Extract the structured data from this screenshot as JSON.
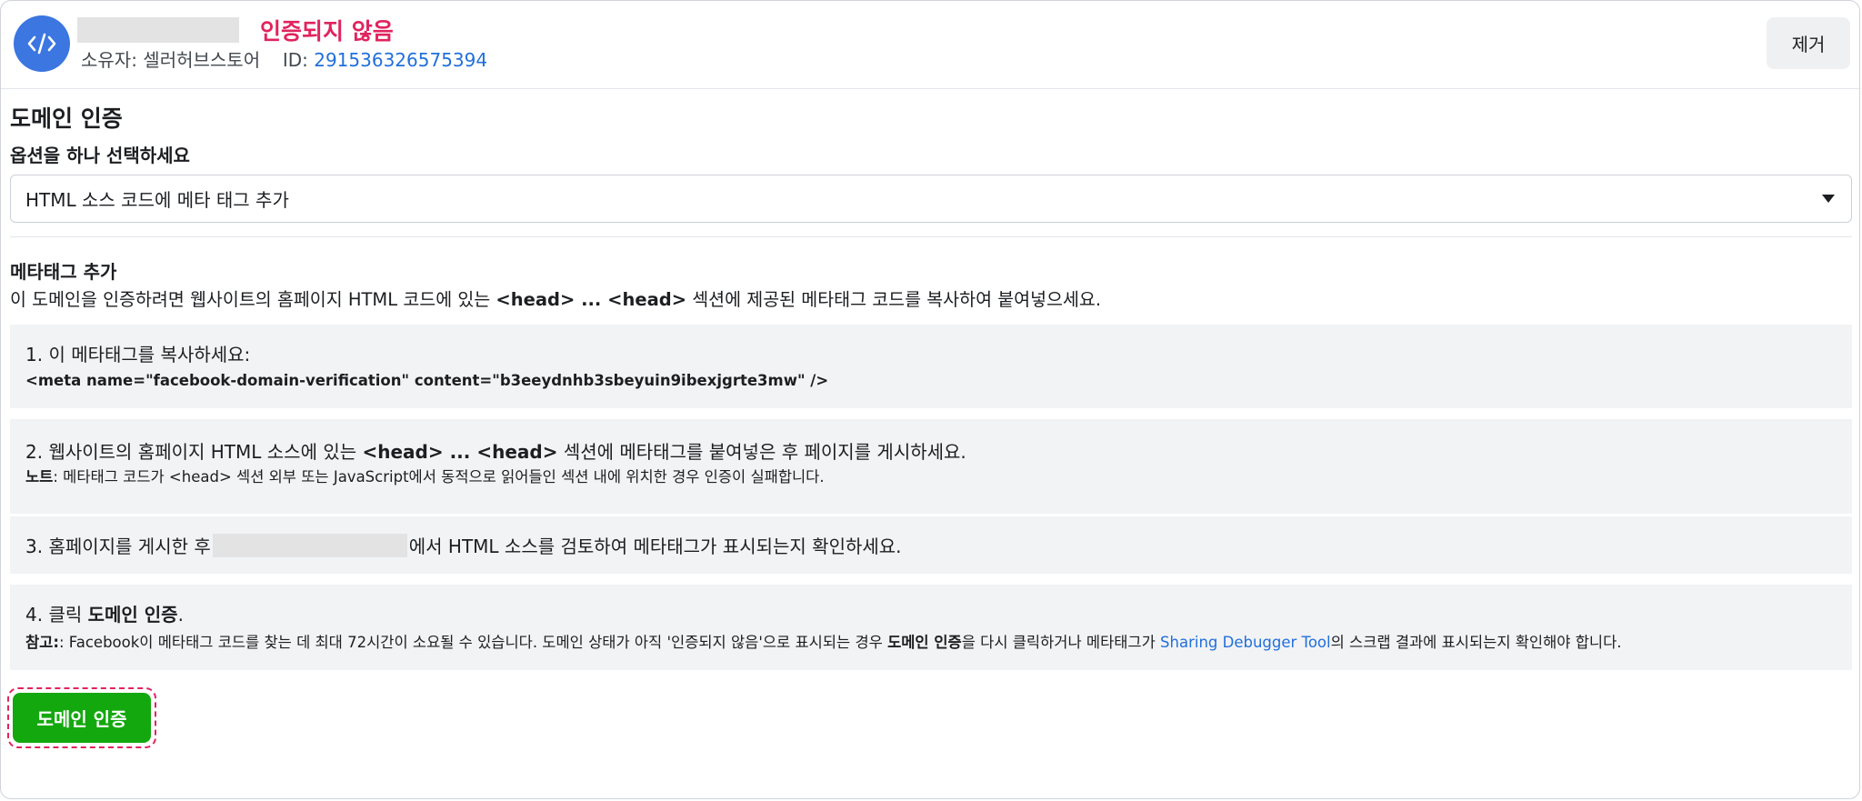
{
  "header": {
    "status": "인증되지 않음",
    "owner_prefix": "소유자: 셀러허브스토어",
    "id_label": "ID: ",
    "id_value": "291536326575394",
    "remove_label": "제거"
  },
  "section": {
    "title": "도메인 인증",
    "select_label": "옵션을 하나 선택하세요",
    "select_value": "HTML 소스 코드에 메타 태그 추가"
  },
  "meta": {
    "title": "메타태그 추가",
    "intro_a": "이 도메인을 인증하려면 웹사이트의 홈페이지 HTML 코드에 있는 ",
    "intro_b": "<head> ... <head>",
    "intro_c": " 섹션에 제공된 메타태그 코드를 복사하여 붙여넣으세요."
  },
  "steps": {
    "s1_text": "1. 이 메타태그를 복사하세요:",
    "s1_code": "<meta name=\"facebook-domain-verification\" content=\"b3eeydnhb3sbeyuin9ibexjgrte3mw\" />",
    "s2_a": "2. 웹사이트의 홈페이지 HTML 소스에 있는 ",
    "s2_b": "<head> ... <head>",
    "s2_c": " 섹션에 메타태그를 붙여넣은 후 페이지를 게시하세요.",
    "s2_note_label": "노트",
    "s2_note": ": 메타태그 코드가 <head> 섹션 외부 또는 JavaScript에서 동적으로 읽어들인 섹션 내에 위치한 경우 인증이 실패합니다.",
    "s3_a": "3. 홈페이지를 게시한 후 ",
    "s3_b": "에서 HTML 소스를 검토하여 메타태그가 표시되는지 확인하세요.",
    "s4_a": "4. 클릭 ",
    "s4_b": "도메인 인증",
    "s4_c": ".",
    "s4_note_label": "참고:",
    "s4_note_a": ": Facebook이 메타태그 코드를 찾는 데 최대 72시간이 소요될 수 있습니다. 도메인 상태가 아직 '인증되지 않음'으로 표시되는 경우 ",
    "s4_note_b": "도메인 인증",
    "s4_note_c": "을 다시 클릭하거나 메타태그가 ",
    "s4_link": "Sharing Debugger Tool",
    "s4_note_d": "의 스크랩 결과에 표시되는지 확인해야 합니다."
  },
  "actions": {
    "verify_label": "도메인 인증"
  },
  "colors": {
    "status": "#e0245e",
    "link": "#216fdb",
    "verify_button": "#14a80f",
    "avatar": "#3b76e1"
  },
  "icons": {
    "avatar": "code-icon",
    "select": "caret-down-icon"
  }
}
